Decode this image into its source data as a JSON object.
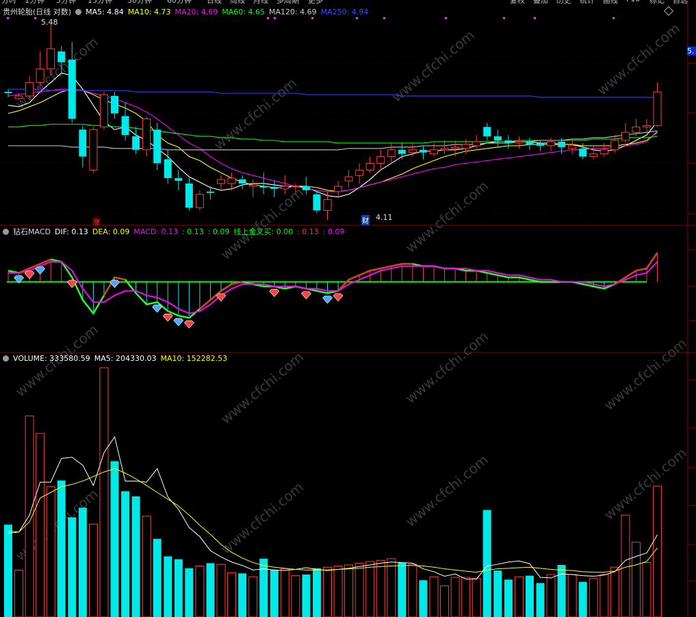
{
  "toolbar_tabs": [
    "分时",
    "1分钟",
    "5分钟",
    "15分钟",
    "30分钟",
    "60分钟",
    "日线",
    "周线",
    "月线",
    "多周期",
    "更多"
  ],
  "toolbar_right": [
    "复权",
    "叠加",
    "历史",
    "统计",
    "画线",
    "F10",
    "标记",
    "自选"
  ],
  "main_panel": {
    "stock_name": "贵州轮胎",
    "period_label": "(日线 对数)",
    "indicators": [
      {
        "label": "MA5",
        "value": "4.84",
        "color": "#ffffff"
      },
      {
        "label": "MA10",
        "value": "4.73",
        "color": "#ffff00"
      },
      {
        "label": "MA20",
        "value": "4.69",
        "color": "#ff00ff"
      },
      {
        "label": "MA60",
        "value": "4.65",
        "color": "#00ff00"
      },
      {
        "label": "MA120",
        "value": "4.69",
        "color": "#c8c8c8"
      },
      {
        "label": "MA250",
        "value": "4.94",
        "color": "#3050ff"
      }
    ],
    "high_label": "5.48",
    "low_label": "4.11",
    "right_price_tag": "5.",
    "event_marker_zhang": "涨",
    "event_marker_cai": "财"
  },
  "macd_panel": {
    "name": "钻石MACD",
    "indicators": [
      {
        "label": "DIF",
        "value": "0.13",
        "color": "#ffffff"
      },
      {
        "label": "DEA",
        "value": "0.09",
        "color": "#ffff00"
      },
      {
        "label": "MACD",
        "value": "0.13",
        "color": "#ff00ff"
      },
      {
        "label": "",
        "value": "0.13",
        "color": "#00ff00"
      },
      {
        "label": "",
        "value": "0.09",
        "color": "#00ff00"
      },
      {
        "label": "线上金叉买",
        "value": "0.00",
        "color": "#00ff00"
      },
      {
        "label": "",
        "value": "0.13",
        "color": "#ff3030"
      },
      {
        "label": "",
        "value": "0.09",
        "color": "#ff00ff"
      }
    ]
  },
  "volume_panel": {
    "name": "VOLUME",
    "indicators": [
      {
        "label": "VOLUME",
        "value": "333580.59",
        "color": "#ffffff"
      },
      {
        "label": "MA5",
        "value": "204330.03",
        "color": "#ffffff"
      },
      {
        "label": "MA10",
        "value": "152282.53",
        "color": "#ffff00"
      }
    ]
  },
  "watermark": "www.cfchi.com",
  "colors": {
    "up": "#ff3c3c",
    "down": "#00e8e8",
    "axis": "#8b0000",
    "grid": "#5a0000",
    "macd_zero": "#00ff00"
  },
  "chart_data": {
    "type": "candlestick",
    "price_range": [
      4.0,
      5.55
    ],
    "candles": [
      [
        4.98,
        4.97,
        5.0,
        4.94
      ],
      [
        4.93,
        4.95,
        4.97,
        4.92
      ],
      [
        4.95,
        5.05,
        5.1,
        4.93
      ],
      [
        5.05,
        5.15,
        5.28,
        5.02
      ],
      [
        5.15,
        5.3,
        5.48,
        5.1
      ],
      [
        5.28,
        5.2,
        5.32,
        5.12
      ],
      [
        5.22,
        4.78,
        5.35,
        4.75
      ],
      [
        4.7,
        4.5,
        4.73,
        4.42
      ],
      [
        4.4,
        4.7,
        4.72,
        4.38
      ],
      [
        4.72,
        4.96,
        4.98,
        4.7
      ],
      [
        4.95,
        4.82,
        4.98,
        4.78
      ],
      [
        4.8,
        4.66,
        4.9,
        4.62
      ],
      [
        4.65,
        4.55,
        4.72,
        4.52
      ],
      [
        4.55,
        4.78,
        4.8,
        4.5
      ],
      [
        4.7,
        4.45,
        4.75,
        4.4
      ],
      [
        4.48,
        4.34,
        4.55,
        4.3
      ],
      [
        4.34,
        4.32,
        4.4,
        4.25
      ],
      [
        4.3,
        4.12,
        4.34,
        4.1
      ],
      [
        4.12,
        4.22,
        4.25,
        4.1
      ],
      [
        4.24,
        4.23,
        4.28,
        4.18
      ],
      [
        4.3,
        4.33,
        4.36,
        4.26
      ],
      [
        4.3,
        4.34,
        4.38,
        4.25
      ],
      [
        4.33,
        4.3,
        4.36,
        4.26
      ],
      [
        4.28,
        4.29,
        4.33,
        4.2
      ],
      [
        4.28,
        4.27,
        4.38,
        4.22
      ],
      [
        4.27,
        4.26,
        4.32,
        4.2
      ],
      [
        4.26,
        4.28,
        4.36,
        4.22
      ],
      [
        4.28,
        4.28,
        4.3,
        4.23
      ],
      [
        4.28,
        4.25,
        4.35,
        4.22
      ],
      [
        4.22,
        4.1,
        4.24,
        4.08
      ],
      [
        4.1,
        4.18,
        4.24,
        4.03
      ],
      [
        4.24,
        4.28,
        4.32,
        4.2
      ],
      [
        4.32,
        4.35,
        4.4,
        4.27
      ],
      [
        4.36,
        4.4,
        4.45,
        4.3
      ],
      [
        4.4,
        4.45,
        4.5,
        4.38
      ],
      [
        4.45,
        4.5,
        4.55,
        4.4
      ],
      [
        4.5,
        4.55,
        4.6,
        4.45
      ],
      [
        4.55,
        4.52,
        4.6,
        4.48
      ],
      [
        4.53,
        4.55,
        4.6,
        4.5
      ],
      [
        4.55,
        4.53,
        4.58,
        4.48
      ],
      [
        4.52,
        4.55,
        4.6,
        4.5
      ],
      [
        4.55,
        4.56,
        4.62,
        4.52
      ],
      [
        4.56,
        4.57,
        4.62,
        4.5
      ],
      [
        4.56,
        4.59,
        4.63,
        4.52
      ],
      [
        4.58,
        4.61,
        4.66,
        4.56
      ],
      [
        4.72,
        4.65,
        4.75,
        4.62
      ],
      [
        4.65,
        4.62,
        4.7,
        4.58
      ],
      [
        4.62,
        4.6,
        4.66,
        4.56
      ],
      [
        4.6,
        4.61,
        4.65,
        4.56
      ],
      [
        4.61,
        4.59,
        4.64,
        4.55
      ],
      [
        4.6,
        4.58,
        4.62,
        4.54
      ],
      [
        4.58,
        4.61,
        4.64,
        4.54
      ],
      [
        4.61,
        4.57,
        4.64,
        4.52
      ],
      [
        4.56,
        4.58,
        4.62,
        4.52
      ],
      [
        4.56,
        4.5,
        4.6,
        4.48
      ],
      [
        4.5,
        4.52,
        4.58,
        4.48
      ],
      [
        4.52,
        4.55,
        4.6,
        4.5
      ],
      [
        4.55,
        4.62,
        4.66,
        4.53
      ],
      [
        4.62,
        4.68,
        4.75,
        4.6
      ],
      [
        4.68,
        4.72,
        4.78,
        4.65
      ],
      [
        4.72,
        4.73,
        4.78,
        4.68
      ],
      [
        4.73,
        4.98,
        5.05,
        4.72
      ]
    ],
    "ma_series": [
      {
        "name": "MA5",
        "values": [
          4.88,
          4.87,
          4.9,
          4.98,
          5.05,
          5.12,
          5.1,
          5.0,
          4.88,
          4.76,
          4.7,
          4.72,
          4.66,
          4.62,
          4.56,
          4.5,
          4.42,
          4.35,
          4.31,
          4.27,
          4.25,
          4.26,
          4.29,
          4.3,
          4.3,
          4.29,
          4.28,
          4.28,
          4.27,
          4.24,
          4.21,
          4.2,
          4.22,
          4.27,
          4.33,
          4.4,
          4.45,
          4.5,
          4.52,
          4.54,
          4.54,
          4.55,
          4.55,
          4.56,
          4.58,
          4.6,
          4.61,
          4.61,
          4.61,
          4.61,
          4.6,
          4.6,
          4.59,
          4.59,
          4.57,
          4.55,
          4.54,
          4.55,
          4.58,
          4.62,
          4.66,
          4.76
        ]
      },
      {
        "name": "MA10",
        "values": [
          4.82,
          4.84,
          4.87,
          4.9,
          4.94,
          4.98,
          5.0,
          4.99,
          4.96,
          4.92,
          4.89,
          4.86,
          4.82,
          4.76,
          4.66,
          4.6,
          4.57,
          4.5,
          4.47,
          4.42,
          4.38,
          4.34,
          4.31,
          4.29,
          4.28,
          4.27,
          4.27,
          4.28,
          4.28,
          4.27,
          4.25,
          4.24,
          4.25,
          4.27,
          4.29,
          4.31,
          4.34,
          4.37,
          4.41,
          4.44,
          4.47,
          4.5,
          4.52,
          4.54,
          4.55,
          4.56,
          4.57,
          4.58,
          4.58,
          4.59,
          4.59,
          4.59,
          4.59,
          4.59,
          4.58,
          4.58,
          4.58,
          4.58,
          4.59,
          4.6,
          4.62,
          4.68
        ]
      },
      {
        "name": "MA20",
        "values": [
          4.95,
          4.96,
          4.97,
          4.98,
          4.99,
          5.0,
          5.0,
          4.99,
          4.97,
          4.95,
          4.93,
          4.9,
          4.87,
          4.83,
          4.78,
          4.72,
          4.66,
          4.6,
          4.56,
          4.5,
          4.45,
          4.41,
          4.38,
          4.36,
          4.34,
          4.32,
          4.3,
          4.28,
          4.26,
          4.25,
          4.24,
          4.24,
          4.25,
          4.27,
          4.29,
          4.31,
          4.33,
          4.35,
          4.37,
          4.39,
          4.41,
          4.42,
          4.44,
          4.45,
          4.46,
          4.47,
          4.48,
          4.49,
          4.5,
          4.51,
          4.52,
          4.53,
          4.54,
          4.55,
          4.55,
          4.56,
          4.56,
          4.57,
          4.58,
          4.59,
          4.61,
          4.69
        ]
      },
      {
        "name": "MA60",
        "values": [
          4.72,
          4.72,
          4.73,
          4.73,
          4.74,
          4.74,
          4.74,
          4.74,
          4.73,
          4.73,
          4.72,
          4.72,
          4.71,
          4.7,
          4.69,
          4.68,
          4.67,
          4.66,
          4.65,
          4.65,
          4.64,
          4.64,
          4.63,
          4.63,
          4.62,
          4.62,
          4.61,
          4.61,
          4.61,
          4.61,
          4.61,
          4.6,
          4.6,
          4.6,
          4.6,
          4.6,
          4.6,
          4.6,
          4.6,
          4.6,
          4.61,
          4.61,
          4.61,
          4.61,
          4.61,
          4.61,
          4.61,
          4.61,
          4.62,
          4.62,
          4.62,
          4.62,
          4.62,
          4.62,
          4.62,
          4.63,
          4.63,
          4.63,
          4.64,
          4.64,
          4.64,
          4.65
        ]
      },
      {
        "name": "MA120",
        "values": [
          4.58,
          4.58,
          4.58,
          4.58,
          4.58,
          4.58,
          4.57,
          4.57,
          4.57,
          4.57,
          4.56,
          4.56,
          4.56,
          4.56,
          4.56,
          4.55,
          4.55,
          4.55,
          4.55,
          4.55,
          4.55,
          4.55,
          4.55,
          4.55,
          4.55,
          4.55,
          4.55,
          4.55,
          4.55,
          4.55,
          4.55,
          4.55,
          4.56,
          4.56,
          4.56,
          4.56,
          4.57,
          4.57,
          4.57,
          4.58,
          4.58,
          4.58,
          4.59,
          4.59,
          4.59,
          4.6,
          4.6,
          4.6,
          4.61,
          4.61,
          4.62,
          4.62,
          4.62,
          4.63,
          4.63,
          4.64,
          4.64,
          4.65,
          4.66,
          4.67,
          4.68,
          4.69
        ]
      },
      {
        "name": "MA250",
        "values": [
          5.0,
          5.0,
          5.0,
          5.0,
          4.99,
          4.99,
          4.99,
          4.99,
          4.99,
          4.99,
          4.99,
          4.99,
          4.98,
          4.98,
          4.98,
          4.98,
          4.98,
          4.98,
          4.98,
          4.98,
          4.97,
          4.97,
          4.97,
          4.97,
          4.97,
          4.97,
          4.97,
          4.97,
          4.96,
          4.96,
          4.96,
          4.96,
          4.96,
          4.96,
          4.96,
          4.96,
          4.96,
          4.95,
          4.95,
          4.95,
          4.95,
          4.95,
          4.95,
          4.95,
          4.95,
          4.95,
          4.95,
          4.95,
          4.95,
          4.95,
          4.94,
          4.94,
          4.94,
          4.94,
          4.94,
          4.94,
          4.94,
          4.94,
          4.94,
          4.94,
          4.94,
          4.94
        ]
      }
    ],
    "macd": {
      "range": [
        -0.26,
        0.2
      ],
      "dif": [
        0.05,
        0.04,
        0.06,
        0.08,
        0.1,
        0.09,
        0.02,
        -0.08,
        -0.14,
        -0.06,
        0.02,
        0.01,
        -0.05,
        -0.1,
        -0.09,
        -0.13,
        -0.15,
        -0.16,
        -0.12,
        -0.08,
        -0.04,
        -0.01,
        0.0,
        -0.01,
        -0.02,
        -0.02,
        -0.03,
        -0.02,
        -0.03,
        -0.04,
        -0.05,
        -0.04,
        0.01,
        0.03,
        0.05,
        0.06,
        0.07,
        0.08,
        0.08,
        0.07,
        0.07,
        0.06,
        0.06,
        0.05,
        0.05,
        0.04,
        0.03,
        0.02,
        0.02,
        0.01,
        0.0,
        0.0,
        0.0,
        0.0,
        -0.01,
        -0.02,
        -0.03,
        -0.01,
        0.02,
        0.05,
        0.06,
        0.13
      ],
      "dea": [
        0.04,
        0.04,
        0.05,
        0.07,
        0.09,
        0.09,
        0.05,
        -0.03,
        -0.09,
        -0.09,
        -0.06,
        -0.04,
        -0.04,
        -0.06,
        -0.07,
        -0.09,
        -0.12,
        -0.14,
        -0.13,
        -0.1,
        -0.06,
        -0.03,
        -0.01,
        -0.01,
        -0.01,
        -0.02,
        -0.02,
        -0.02,
        -0.03,
        -0.03,
        -0.04,
        -0.04,
        -0.01,
        0.01,
        0.03,
        0.05,
        0.06,
        0.07,
        0.07,
        0.07,
        0.07,
        0.06,
        0.06,
        0.06,
        0.05,
        0.05,
        0.04,
        0.03,
        0.03,
        0.02,
        0.01,
        0.01,
        0.0,
        0.0,
        0.0,
        -0.01,
        -0.02,
        -0.01,
        0.01,
        0.03,
        0.04,
        0.09
      ],
      "buy_markers": [
        1,
        3,
        10,
        14,
        16,
        30
      ],
      "sell_markers": [
        2,
        6,
        15,
        17,
        20,
        25,
        28,
        31
      ]
    },
    "volume": {
      "max": 440000,
      "values": [
        163000,
        83000,
        355000,
        324000,
        230000,
        241000,
        176000,
        193000,
        164000,
        440000,
        275000,
        222000,
        213000,
        178000,
        138000,
        107000,
        102000,
        86000,
        90000,
        95000,
        93000,
        78000,
        77000,
        71000,
        103000,
        83000,
        85000,
        73000,
        75000,
        86000,
        88000,
        90000,
        92000,
        95000,
        98000,
        100000,
        103000,
        96000,
        93000,
        65000,
        71000,
        55000,
        70000,
        70000,
        68000,
        189000,
        82000,
        66000,
        71000,
        73000,
        60000,
        75000,
        92000,
        75000,
        62000,
        68000,
        75000,
        88000,
        180000,
        132000,
        96000,
        231000
      ],
      "ma5": [
        148000,
        150000,
        180000,
        238000,
        238000,
        280000,
        282000,
        268000,
        232000,
        290000,
        318000,
        240000,
        240000,
        238000,
        262000,
        212000,
        190000,
        158000,
        142000,
        117000,
        106000,
        97000,
        91000,
        83000,
        85000,
        83000,
        82000,
        84000,
        87000,
        84000,
        82000,
        84000,
        86000,
        89000,
        92000,
        95000,
        97000,
        96000,
        95000,
        85000,
        80000,
        72000,
        76000,
        67000,
        67000,
        90000,
        93000,
        97000,
        99000,
        94000,
        70000,
        69000,
        76000,
        75000,
        73000,
        72000,
        74000,
        80000,
        100000,
        107000,
        113000,
        145000
      ],
      "ma10": [
        152000,
        150000,
        168000,
        210000,
        220000,
        230000,
        234000,
        240000,
        248000,
        256000,
        262000,
        254000,
        244000,
        232000,
        220000,
        208000,
        196000,
        180000,
        162000,
        146000,
        128000,
        114000,
        104000,
        96000,
        91000,
        88000,
        86000,
        84000,
        83000,
        83000,
        83000,
        84000,
        85000,
        86000,
        88000,
        89000,
        90000,
        91000,
        91000,
        90000,
        88000,
        85000,
        83000,
        81000,
        79000,
        83000,
        85000,
        86000,
        87000,
        88000,
        86000,
        84000,
        83000,
        82000,
        80000,
        79000,
        79000,
        81000,
        88000,
        92000,
        98000,
        122000
      ]
    }
  }
}
